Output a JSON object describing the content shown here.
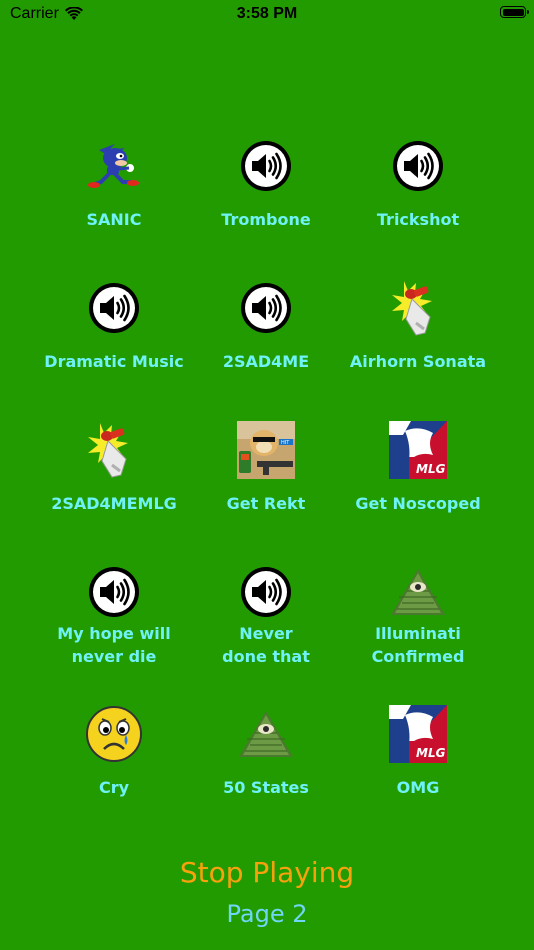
{
  "status_bar": {
    "carrier": "Carrier",
    "time": "3:58 PM"
  },
  "sounds": [
    {
      "label": "SANIC",
      "icon": "sanic-icon"
    },
    {
      "label": "Trombone",
      "icon": "speaker-icon"
    },
    {
      "label": "Trickshot",
      "icon": "speaker-icon"
    },
    {
      "label": "Dramatic Music",
      "icon": "speaker-icon"
    },
    {
      "label": "2SAD4ME",
      "icon": "speaker-icon"
    },
    {
      "label": "Airhorn Sonata",
      "icon": "airhorn-icon"
    },
    {
      "label": "2SAD4MEMLG",
      "icon": "airhorn-icon"
    },
    {
      "label": "Get Rekt",
      "icon": "doge-icon"
    },
    {
      "label": "Get Noscoped",
      "icon": "mlg-icon"
    },
    {
      "label": "My hope will\nnever die",
      "icon": "speaker-icon"
    },
    {
      "label": "Never\ndone that",
      "icon": "speaker-icon"
    },
    {
      "label": "Illuminati\nConfirmed",
      "icon": "illuminati-icon"
    },
    {
      "label": "Cry",
      "icon": "crying-face-icon"
    },
    {
      "label": "50 States",
      "icon": "illuminati-icon"
    },
    {
      "label": "OMG",
      "icon": "mlg-icon"
    }
  ],
  "mlg_logo_text": "MLG",
  "controls": {
    "stop_label": "Stop Playing",
    "page_label": "Page 2"
  }
}
